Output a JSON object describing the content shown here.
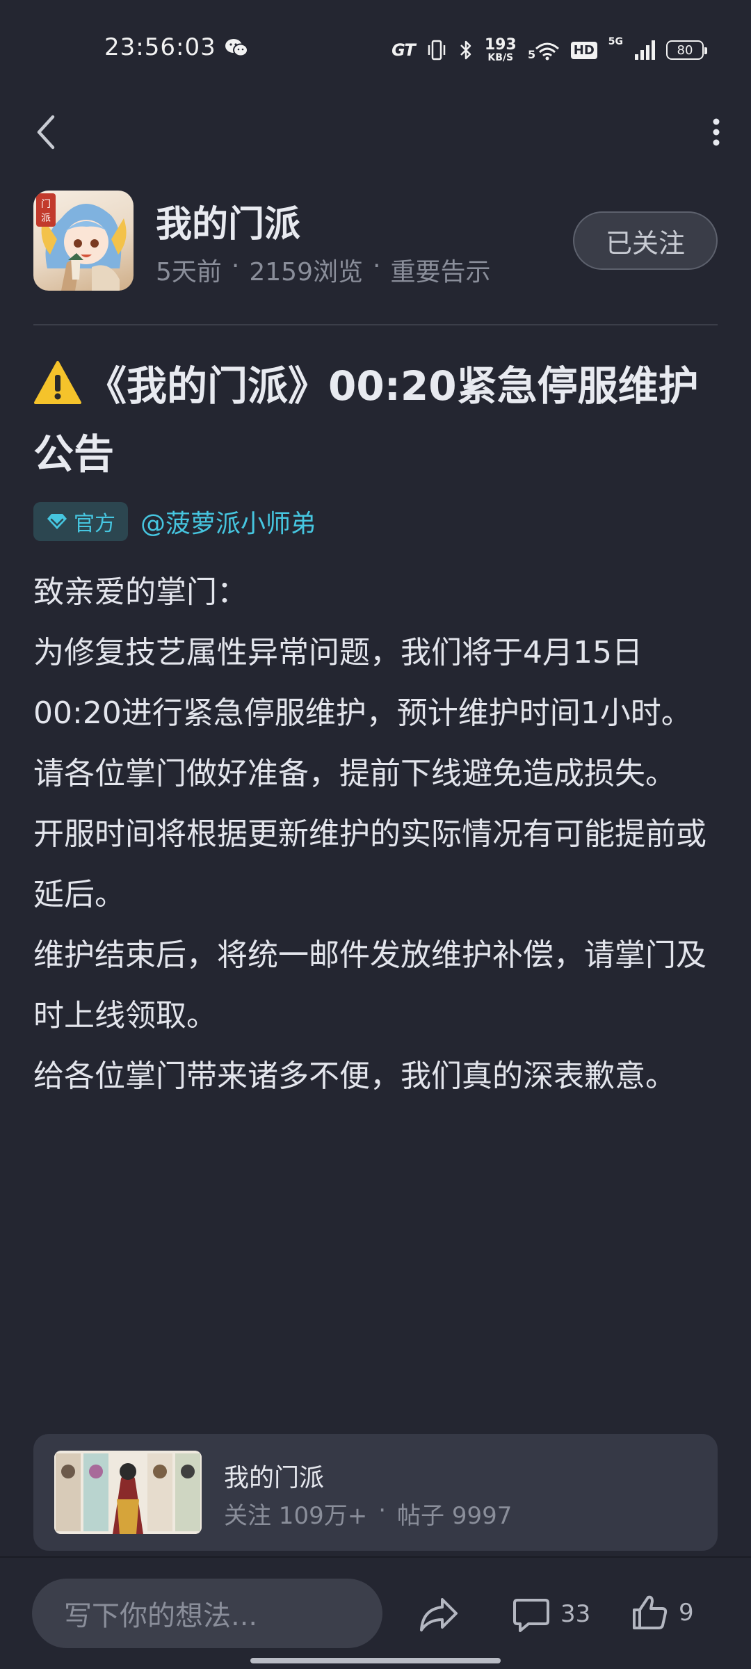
{
  "status_bar": {
    "time": "23:56:03",
    "speed_value": "193",
    "speed_unit": "KB/S",
    "network_label": "5G",
    "hd_label": "HD",
    "gt_label": "GT",
    "battery": "80"
  },
  "author": {
    "name": "我的门派",
    "meta": [
      "5天前",
      "·",
      "2159浏览",
      "·",
      "重要告示"
    ],
    "follow_label": "已关注",
    "avatar_badge": "门派"
  },
  "post": {
    "title": "《我的门派》00:20紧急停服维护公告",
    "official_label": "官方",
    "mention": "@菠萝派小师弟",
    "paragraphs": [
      "致亲爱的掌门：",
      "为修复技艺属性异常问题，我们将于4月15日00:20进行紧急停服维护，预计维护时间1小时。",
      "请各位掌门做好准备，提前下线避免造成损失。",
      "开服时间将根据更新维护的实际情况有可能提前或延后。",
      "维护结束后，将统一邮件发放维护补偿，请掌门及时上线领取。",
      "给各位掌门带来诸多不便，我们真的深表歉意。"
    ]
  },
  "community": {
    "name": "我的门派",
    "followers": "关注 109万+",
    "separator": "·",
    "posts": "帖子 9997"
  },
  "bottom_bar": {
    "input_placeholder": "写下你的想法...",
    "comment_count": "33",
    "like_count": "9"
  },
  "colors": {
    "background": "#242631",
    "accent": "#46c6e0",
    "card": "#363946",
    "muted_text": "#8a8e9a"
  },
  "icons": [
    "wechat-icon",
    "vibrate-icon",
    "bluetooth-icon",
    "wifi-icon",
    "signal-icon",
    "battery-icon",
    "back-icon",
    "more-vertical-icon",
    "warning-icon",
    "diamond-icon",
    "share-icon",
    "comment-icon",
    "like-icon"
  ]
}
